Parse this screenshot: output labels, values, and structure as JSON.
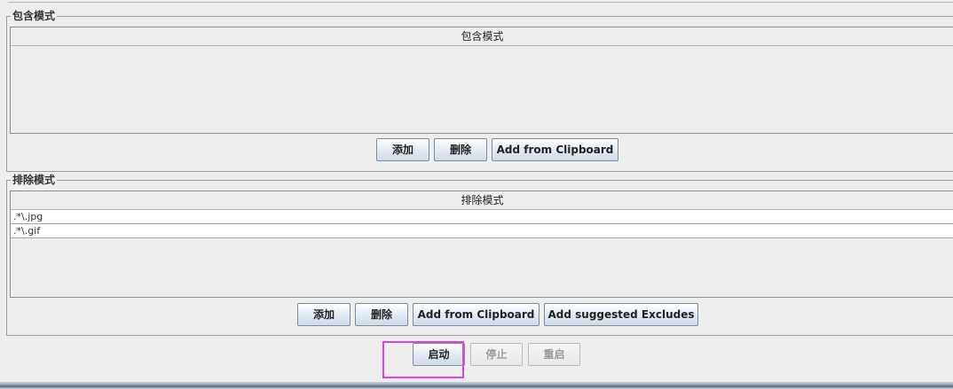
{
  "include_panel": {
    "title": "包含模式",
    "column_header": "包含模式",
    "rows": [],
    "buttons": {
      "add": "添加",
      "delete": "删除",
      "add_clipboard": "Add from Clipboard"
    }
  },
  "exclude_panel": {
    "title": "排除模式",
    "column_header": "排除模式",
    "rows": [
      ".*\\.jpg",
      ".*\\.gif"
    ],
    "buttons": {
      "add": "添加",
      "delete": "删除",
      "add_clipboard": "Add from Clipboard",
      "add_suggested": "Add suggested Excludes"
    }
  },
  "controls": {
    "start": "启动",
    "stop": "停止",
    "restart": "重启",
    "stop_enabled": false,
    "restart_enabled": false
  },
  "colors": {
    "highlight": "#e040e0",
    "background": "#eeeeee"
  }
}
